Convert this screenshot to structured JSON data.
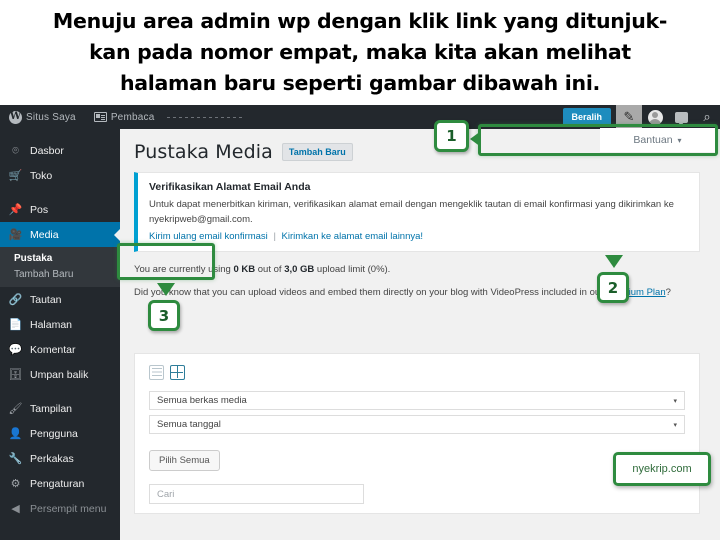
{
  "caption": {
    "lines": [
      "Menuju area admin wp dengan klik link yang ditunjuk-",
      "kan pada nomor empat, maka kita akan melihat",
      "halaman baru seperti gambar dibawah ini."
    ]
  },
  "adminbar": {
    "wp_logo": "W",
    "site_label": "Situs Saya",
    "reader_label": "Pembaca",
    "switch_button": "Beralih",
    "icons": [
      {
        "name": "write-pencil-icon",
        "glyph": "✎"
      },
      {
        "name": "avatar-icon",
        "glyph": ""
      },
      {
        "name": "comments-icon",
        "glyph": ""
      },
      {
        "name": "search-icon",
        "glyph": "⌕"
      }
    ]
  },
  "help": {
    "label": "Bantuan",
    "caret": "▾"
  },
  "sidebar": {
    "items": [
      {
        "label": "Dasbor",
        "icon": "dashboard-icon",
        "glyph": "⌾"
      },
      {
        "label": "Toko",
        "icon": "store-cart-icon",
        "glyph": "Ὥ2"
      },
      {
        "label": "Pos",
        "icon": "posts-pin-icon",
        "glyph": "✒"
      },
      {
        "label": "Media",
        "icon": "media-icon",
        "glyph": "■"
      },
      {
        "label": "Tautan",
        "icon": "links-chain-icon",
        "glyph": "⚭"
      },
      {
        "label": "Halaman",
        "icon": "pages-icon",
        "glyph": "▧"
      },
      {
        "label": "Komentar",
        "icon": "comments-icon",
        "glyph": "●"
      },
      {
        "label": "Umpan balik",
        "icon": "feedback-icon",
        "glyph": "▤"
      },
      {
        "label": "Tampilan",
        "icon": "appearance-brush-icon",
        "glyph": "✎"
      },
      {
        "label": "Pengguna",
        "icon": "users-icon",
        "glyph": "♟"
      },
      {
        "label": "Perkakas",
        "icon": "tools-wrench-icon",
        "glyph": "⚒"
      },
      {
        "label": "Pengaturan",
        "icon": "settings-icon",
        "glyph": "⚙"
      },
      {
        "label": "Persempit menu",
        "icon": "collapse-icon",
        "glyph": "◀"
      }
    ],
    "submenu": [
      {
        "label": "Pustaka",
        "active": true
      },
      {
        "label": "Tambah Baru",
        "active": false
      }
    ]
  },
  "page": {
    "title": "Pustaka Media",
    "add_new_button": "Tambah Baru"
  },
  "notice": {
    "title": "Verifikasikan Alamat Email Anda",
    "body": "Untuk dapat menerbitkan kiriman, verifikasikan alamat email dengan mengeklik tautan di email konfirmasi yang dikirimkan ke nyekripweb@gmail.com.",
    "link1": "Kirim ulang email konfirmasi",
    "separator": "|",
    "link2": "Kirimkan ke alamat email lainnya!"
  },
  "usage": {
    "prefix": "You are currently using ",
    "used": "0 KB",
    "middle": " out of ",
    "total": "3,0 GB",
    "suffix": " upload limit (0%).",
    "videopress_text": "Did you know that you can upload videos and embed them directly on your blog with VideoPress included in our ",
    "premium_link": "Premium Plan",
    "videopress_end": "?"
  },
  "media_toolbar": {
    "view_list_icon": "list-view-icon",
    "view_grid_icon": "grid-view-icon",
    "filter_type": "Semua berkas media",
    "filter_date": "Semua tanggal",
    "caret": "▾",
    "select_all_button": "Pilih Semua",
    "search_placeholder": "Cari"
  },
  "annotations": {
    "callout_1": "1",
    "callout_2": "2",
    "callout_3": "3",
    "watermark": "nyekrip.com",
    "accent_color": "#2e8b3f"
  }
}
